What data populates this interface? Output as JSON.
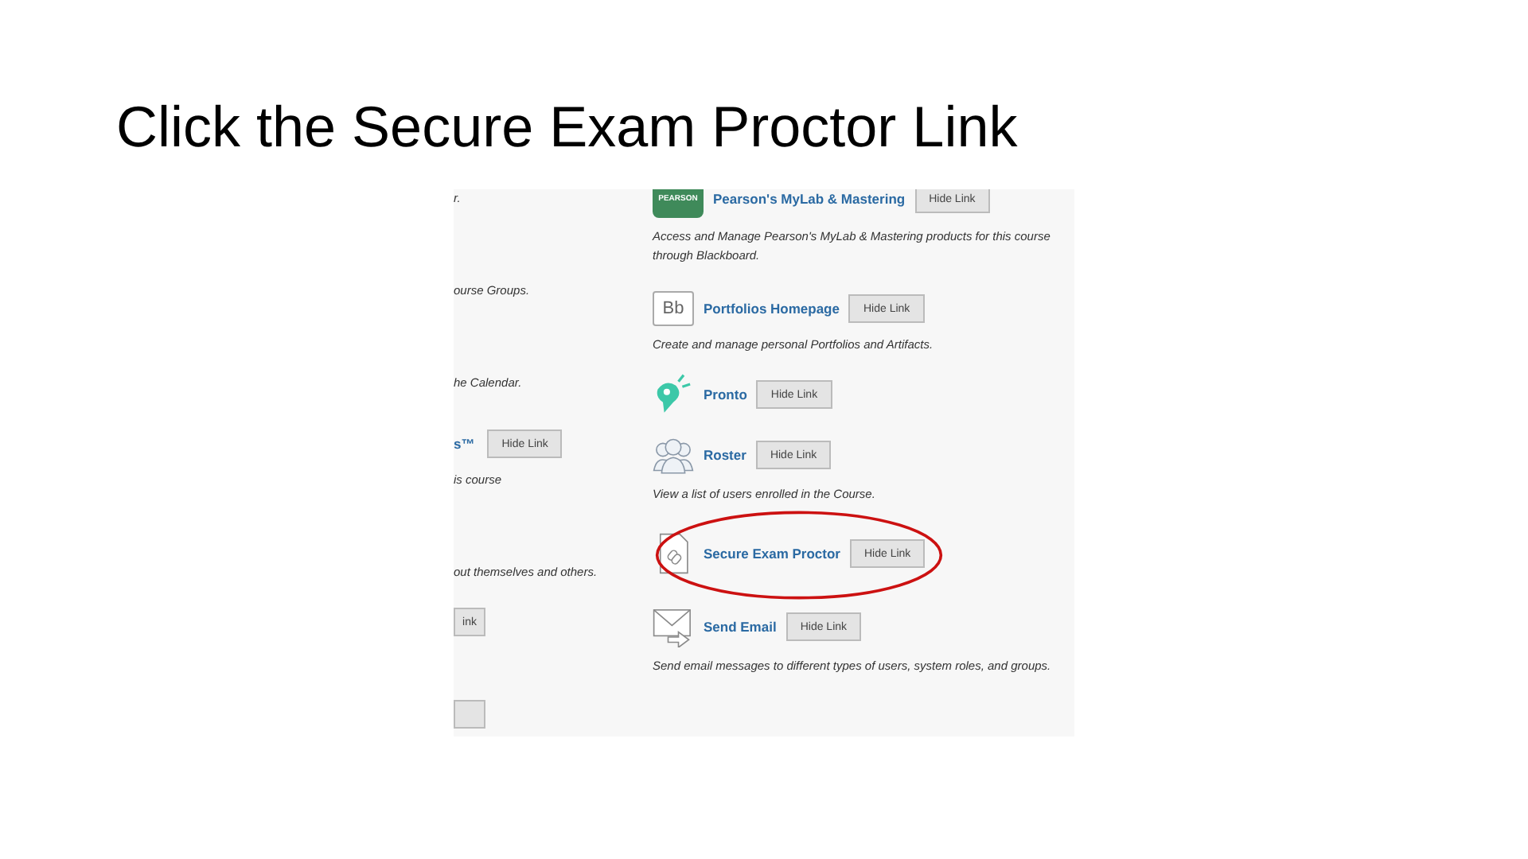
{
  "title": "Click the Secure Exam Proctor Link",
  "left_fragments": [
    {
      "kind": "text",
      "text": "r."
    },
    {
      "kind": "text",
      "text": "ourse Groups."
    },
    {
      "kind": "text",
      "text": "he Calendar."
    },
    {
      "kind": "link",
      "text": "s™",
      "button": "Hide Link"
    },
    {
      "kind": "text",
      "text": "is course"
    },
    {
      "kind": "text",
      "text": "out themselves and others."
    },
    {
      "kind": "button",
      "button": "ink"
    },
    {
      "kind": "button"
    }
  ],
  "tools": [
    {
      "name": "Pearson's MyLab & Mastering",
      "kind": "pearson",
      "icon_text": "PEARSON",
      "button": "Hide Link",
      "description": "Access and Manage Pearson's MyLab & Mastering products for this course through Blackboard.",
      "circled": false
    },
    {
      "name": "Portfolios Homepage",
      "kind": "bb",
      "icon_text": "Bb",
      "button": "Hide Link",
      "description": "Create and manage personal Portfolios and Artifacts.",
      "circled": false
    },
    {
      "name": "Pronto",
      "kind": "pronto",
      "button": "Hide Link",
      "circled": false
    },
    {
      "name": "Roster",
      "kind": "people",
      "button": "Hide Link",
      "description": "View a list of users enrolled in the Course.",
      "circled": false
    },
    {
      "name": "Secure Exam Proctor",
      "kind": "file-link",
      "button": "Hide Link",
      "circled": true
    },
    {
      "name": "Send Email",
      "kind": "envelope",
      "button": "Hide Link",
      "description": "Send email messages to different types of users, system roles, and groups.",
      "circled": false
    }
  ]
}
